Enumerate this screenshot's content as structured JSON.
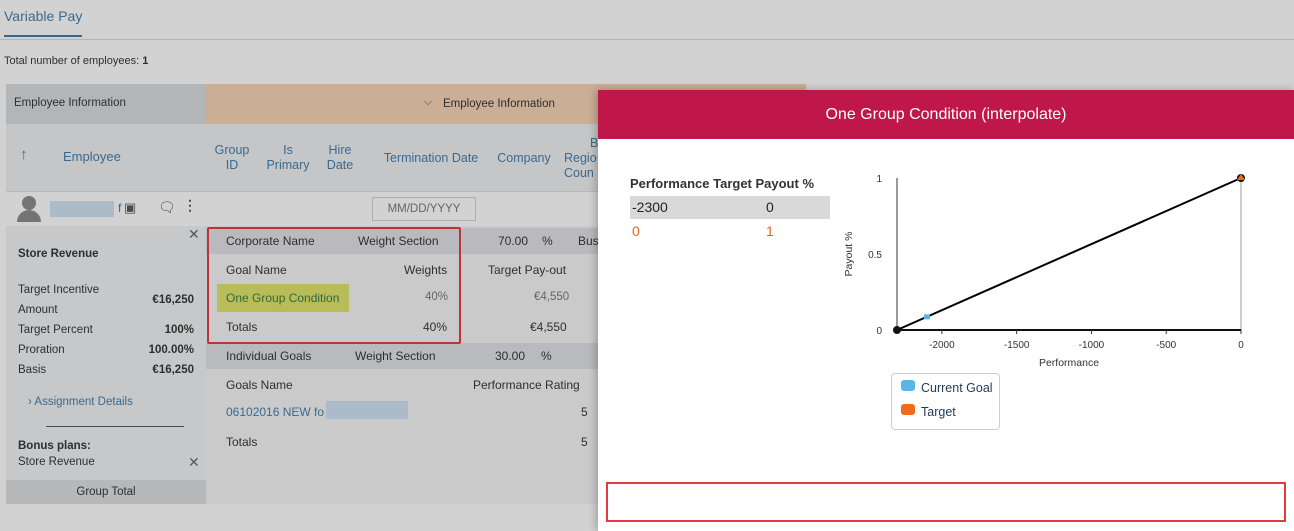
{
  "tab": {
    "label": "Variable Pay"
  },
  "summary": {
    "label": "Total number of employees:",
    "count": "1"
  },
  "left_panel": {
    "header": "Employee Information",
    "employee_col": "Employee",
    "employee_name_tail": "f",
    "plan_title": "Store Revenue",
    "fields": [
      {
        "label": "Target Incentive",
        "label2": "Amount",
        "value": "€16,250"
      },
      {
        "label": "Target Percent",
        "value": "100%"
      },
      {
        "label": "Proration",
        "value": "100.00%"
      },
      {
        "label": "Basis",
        "value": "€16,250"
      }
    ],
    "assignment_link": "Assignment Details",
    "bonus_plans_label": "Bonus plans:",
    "bonus_plan_item": "Store Revenue",
    "group_total": "Group Total"
  },
  "right_header": {
    "label": "Employee Information"
  },
  "columns": [
    {
      "l1": "Group",
      "l2": "ID"
    },
    {
      "l1": "Is",
      "l2": "Primary"
    },
    {
      "l1": "Hire",
      "l2": "Date"
    },
    {
      "l1": "Termination Date",
      "l2": ""
    },
    {
      "l1": "Company",
      "l2": ""
    },
    {
      "l1": "B",
      "l2": "Regio",
      "l3": "Coun"
    }
  ],
  "date_placeholder": "MM/DD/YYYY",
  "grid": {
    "corporate": {
      "name": "Corporate Name",
      "weight_label": "Weight Section",
      "weight": "70.00",
      "unit": "%",
      "extra": "Bus"
    },
    "goal_header": {
      "name": "Goal Name",
      "weights": "Weights",
      "payout": "Target Pay-out"
    },
    "goal_row": {
      "name": "One Group Condition",
      "weight": "40%",
      "payout": "€4,550"
    },
    "totals_1": {
      "label": "Totals",
      "weight": "40%",
      "payout": "€4,550"
    },
    "individual": {
      "name": "Individual Goals",
      "weight_label": "Weight Section",
      "weight": "30.00",
      "unit": "%"
    },
    "goals_header": {
      "name": "Goals Name",
      "rating": "Performance Rating"
    },
    "goal2_row": {
      "name": "06102016 NEW fo",
      "rating": "5"
    },
    "totals_2": {
      "label": "Totals",
      "rating": "5"
    }
  },
  "dialog": {
    "title": "One Group Condition (interpolate)",
    "table": {
      "col1": "Performance",
      "col2": "Target Payout %",
      "rows": [
        {
          "performance": "-2300",
          "payout": "0"
        },
        {
          "performance": "0",
          "payout": "1"
        }
      ]
    },
    "legend": [
      {
        "label": "Current Goal",
        "color": "#5ab4e5"
      },
      {
        "label": "Target",
        "color": "#f26b1d"
      }
    ]
  },
  "chart_data": {
    "type": "line",
    "xlabel": "Performance",
    "ylabel": "Payout %",
    "x_ticks": [
      "-2000",
      "-1500",
      "-1000",
      "-500",
      "0"
    ],
    "y_ticks": [
      "0",
      "0.5",
      "1"
    ],
    "xlim": [
      -2300,
      0
    ],
    "ylim": [
      0,
      1
    ],
    "series": [
      {
        "name": "Target",
        "x": [
          -2300,
          0
        ],
        "y": [
          0,
          1
        ],
        "color": "#000000"
      },
      {
        "name": "Current Goal",
        "x": [
          -2100
        ],
        "y": [
          0.09
        ],
        "color": "#5ab4e5"
      }
    ],
    "target_marker": {
      "x": 0,
      "y": 1,
      "color": "#f26b1d"
    }
  }
}
